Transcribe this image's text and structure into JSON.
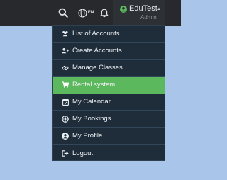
{
  "header": {
    "language_code": "EN",
    "user_name": "EduTest",
    "user_role": "Admin"
  },
  "menu": {
    "items": [
      {
        "label": "List of Accounts",
        "icon": "users-icon"
      },
      {
        "label": "Create Accounts",
        "icon": "user-plus-icon"
      },
      {
        "label": "Manage Classes",
        "icon": "link-icon"
      },
      {
        "label": "Rental system",
        "icon": "cart-icon",
        "active": true
      },
      {
        "label": "My Calendar",
        "icon": "calendar-check-icon"
      },
      {
        "label": "My Bookings",
        "icon": "bookings-icon"
      },
      {
        "label": "My Profile",
        "icon": "user-circle-icon"
      },
      {
        "label": "Logout",
        "icon": "sign-out-icon"
      }
    ]
  },
  "colors": {
    "topbar": "#27292d",
    "menu_bg": "#1f2d3a",
    "active": "#5cb85c",
    "page_bg": "#a9c5ea",
    "avatar": "#5cb85c"
  }
}
